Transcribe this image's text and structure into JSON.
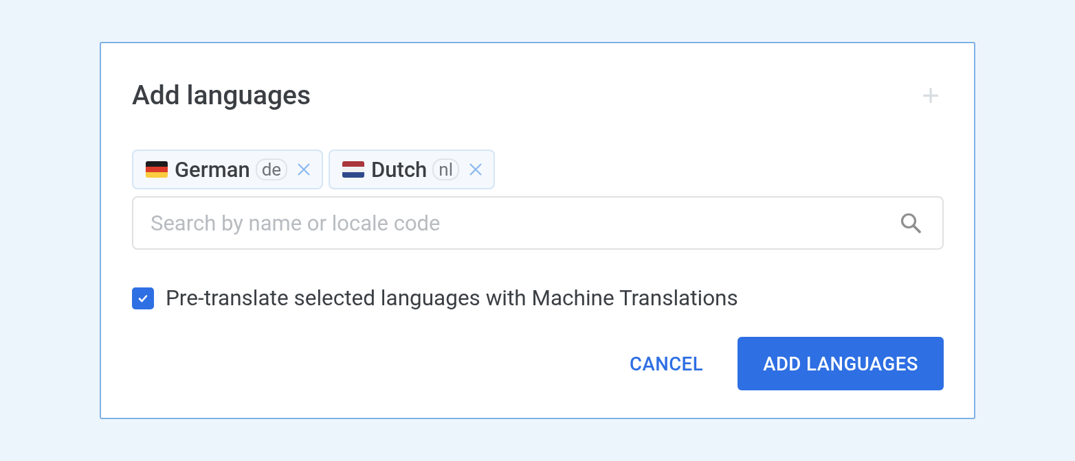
{
  "dialog": {
    "title": "Add languages",
    "add_icon": "+"
  },
  "chips": [
    {
      "name": "German",
      "code": "de",
      "kind": "germany"
    },
    {
      "name": "Dutch",
      "code": "nl",
      "kind": "netherlands"
    }
  ],
  "search": {
    "placeholder": "Search by name or locale code"
  },
  "pretranslate": {
    "label": "Pre-translate selected languages with Machine Translations",
    "checked": true
  },
  "buttons": [
    {
      "label": "CANCEL",
      "kind": "text"
    },
    {
      "label": "ADD LANGUAGES",
      "kind": "primary"
    }
  ]
}
